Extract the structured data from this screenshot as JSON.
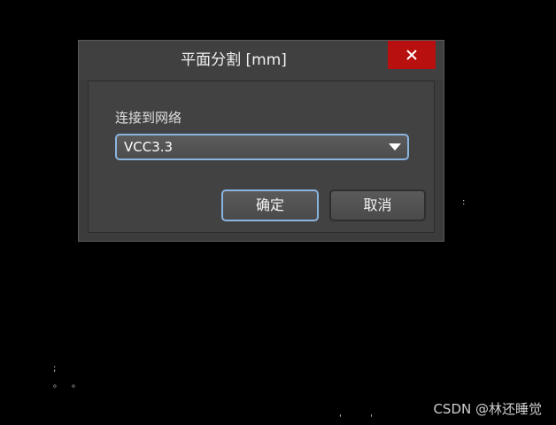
{
  "dialog": {
    "title": "平面分割 [mm]",
    "close_icon": "close-icon",
    "net_label": "连接到网络",
    "net_value": "VCC3.3",
    "ok_label": "确定",
    "cancel_label": "取消"
  },
  "watermark": "CSDN @林还睡觉",
  "colors": {
    "background": "#000000",
    "dialog": "#3c3c3c",
    "close_button": "#b80f0f",
    "focus_border": "#8ab4e0"
  }
}
